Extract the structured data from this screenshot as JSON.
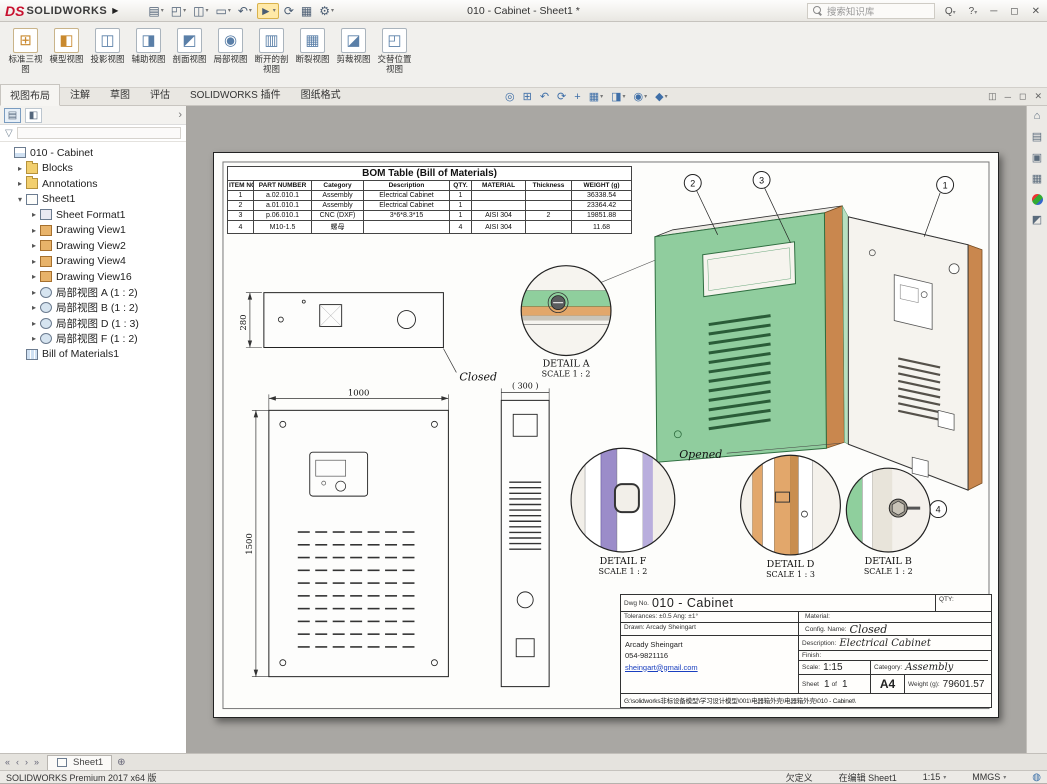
{
  "icons": {
    "menu_arrow": "▶",
    "new": "▤",
    "open": "◰",
    "save": "◫",
    "print": "▭",
    "undo": "↶",
    "select": "►",
    "rebuild": "⟳",
    "props": "▦",
    "options": "⚙",
    "search_scope": "Q",
    "help": "?",
    "minimize": "─",
    "maximize": "◻",
    "close": "✕",
    "dropdown": "▾",
    "hud_zoom_fit": "◎",
    "hud_zoom_area": "⊞",
    "hud_prev_view": "↶",
    "hud_rotate": "⟳",
    "hud_pan": "+",
    "hud_orientation": "▦",
    "hud_display": "◨",
    "hud_visibility": "◉",
    "hud_appearance": "◆",
    "pane": "◫",
    "lp_tab_tree": "▤",
    "lp_tab_props": "◧",
    "lp_chevron": "›",
    "filter": "▽",
    "task_home": "⌂",
    "task_lib": "▤",
    "task_explorer": "▣",
    "task_palette": "▦",
    "task_appear": "●",
    "task_props": "◩",
    "nav_first": "«",
    "nav_prev": "‹",
    "nav_next": "›",
    "nav_last": "»",
    "add_sheet": "⊕",
    "status_globe": "◍"
  },
  "titlebar": {
    "logo_ds": "DS",
    "logo_name": "SOLIDWORKS",
    "doc_title": "010 - Cabinet - Sheet1 *",
    "search_placeholder": "搜索知识库"
  },
  "ribbon": {
    "buttons": [
      {
        "label": "标准三视图",
        "glyph": "⊞"
      },
      {
        "label": "模型视图",
        "glyph": "◧"
      },
      {
        "label": "投影视图",
        "glyph": "◫"
      },
      {
        "label": "辅助视图",
        "glyph": "◨"
      },
      {
        "label": "剖面视图",
        "glyph": "◩"
      },
      {
        "label": "局部视图",
        "glyph": "◉"
      },
      {
        "label": "断开的剖视图",
        "glyph": "▥"
      },
      {
        "label": "断裂视图",
        "glyph": "▦"
      },
      {
        "label": "剪裁视图",
        "glyph": "◪"
      },
      {
        "label": "交替位置视图",
        "glyph": "◰"
      }
    ]
  },
  "tabs": [
    {
      "label": "视图布局"
    },
    {
      "label": "注解"
    },
    {
      "label": "草图"
    },
    {
      "label": "评估"
    },
    {
      "label": "SOLIDWORKS 插件"
    },
    {
      "label": "图纸格式"
    }
  ],
  "feature_tree": {
    "items": [
      {
        "label": "010 - Cabinet",
        "arrow": ""
      },
      {
        "label": "Blocks",
        "arrow": "▸"
      },
      {
        "label": "Annotations",
        "arrow": "▸"
      },
      {
        "label": "Sheet1",
        "arrow": "▾"
      },
      {
        "label": "Sheet Format1",
        "arrow": "▸"
      },
      {
        "label": "Drawing View1",
        "arrow": "▸"
      },
      {
        "label": "Drawing View2",
        "arrow": "▸"
      },
      {
        "label": "Drawing View4",
        "arrow": "▸"
      },
      {
        "label": "Drawing View16",
        "arrow": "▸"
      },
      {
        "label": "局部视图 A (1 : 2)",
        "arrow": "▸"
      },
      {
        "label": "局部视图 B (1 : 2)",
        "arrow": "▸"
      },
      {
        "label": "局部视图 D (1 : 3)",
        "arrow": "▸"
      },
      {
        "label": "局部视图 F (1 : 2)",
        "arrow": "▸"
      },
      {
        "label": "Bill of Materials1",
        "arrow": ""
      }
    ]
  },
  "bom_table": {
    "title": "BOM Table (Bill of Materials)",
    "headers": [
      "ITEM NO.",
      "PART NUMBER",
      "Category",
      "Description",
      "QTY.",
      "MATERIAL",
      "Thickness",
      "WEIGHT (g)"
    ],
    "rows": [
      [
        "1",
        "a.02.010.1",
        "Assembly",
        "Electrical Cabinet",
        "1",
        "",
        "",
        "36338.54"
      ],
      [
        "2",
        "a.01.010.1",
        "Assembly",
        "Electrical Cabinet",
        "1",
        "",
        "",
        "23364.42"
      ],
      [
        "3",
        "p.06.010.1",
        "CNC (DXF)",
        "3*6*8.3*15",
        "1",
        "AISI 304",
        "2",
        "19851.88"
      ],
      [
        "4",
        "M10-1.5",
        "螺母",
        "",
        "4",
        "AISI 304",
        "",
        "11.68"
      ]
    ]
  },
  "drawing": {
    "dim_280": "280",
    "dim_1000": "1000",
    "dim_1500": "1500",
    "dim_300": "( 300 )",
    "closed_label": "Closed",
    "opened_label": "Opened",
    "details": [
      {
        "name": "DETAIL A",
        "scale": "SCALE 1 : 2"
      },
      {
        "name": "DETAIL F",
        "scale": "SCALE 1 : 2"
      },
      {
        "name": "DETAIL D",
        "scale": "SCALE 1 : 3"
      },
      {
        "name": "DETAIL B",
        "scale": "SCALE 1 : 2"
      }
    ],
    "balloons": [
      "1",
      "2",
      "3",
      "4"
    ]
  },
  "title_block": {
    "dwg_label": "Dwg No.",
    "dwg_no": "010 - Cabinet",
    "qty_label": "QTY:",
    "tolerances": "Tolerances: ±0.5  Ang: ±1°",
    "material_label": "Material:",
    "drawn": "Drawn: Arcady Sheingart",
    "config_label": "Config. Name:",
    "config_value": "Closed",
    "author_name": "Arcady Sheingart",
    "author_phone": "054-9821116",
    "author_email": "sheingart@gmail.com",
    "description_label": "Description:",
    "description_value": "Electrical Cabinet",
    "finish_label": "Finish:",
    "scale_label": "Scale:",
    "scale_value": "1:15",
    "category_label": "Category:",
    "category_value": "Assembly",
    "sheet_label": "Sheet",
    "sheet_num": "1",
    "of_label": "of",
    "sheet_total": "1",
    "size": "A4",
    "weight_label": "Weight (g):",
    "weight_value": "79601.57",
    "path": "G:\\solidworks非标设备模型\\学习设计模型\\001\\电器箱外壳\\电器箱外壳\\010 - Cabinet\\"
  },
  "sheet_tab": {
    "label": "Sheet1"
  },
  "statusbar": {
    "app": "SOLIDWORKS Premium 2017 x64 版",
    "definition": "欠定义",
    "editing": "在编辑 Sheet1",
    "scale": "1:15",
    "units": "MMGS"
  }
}
